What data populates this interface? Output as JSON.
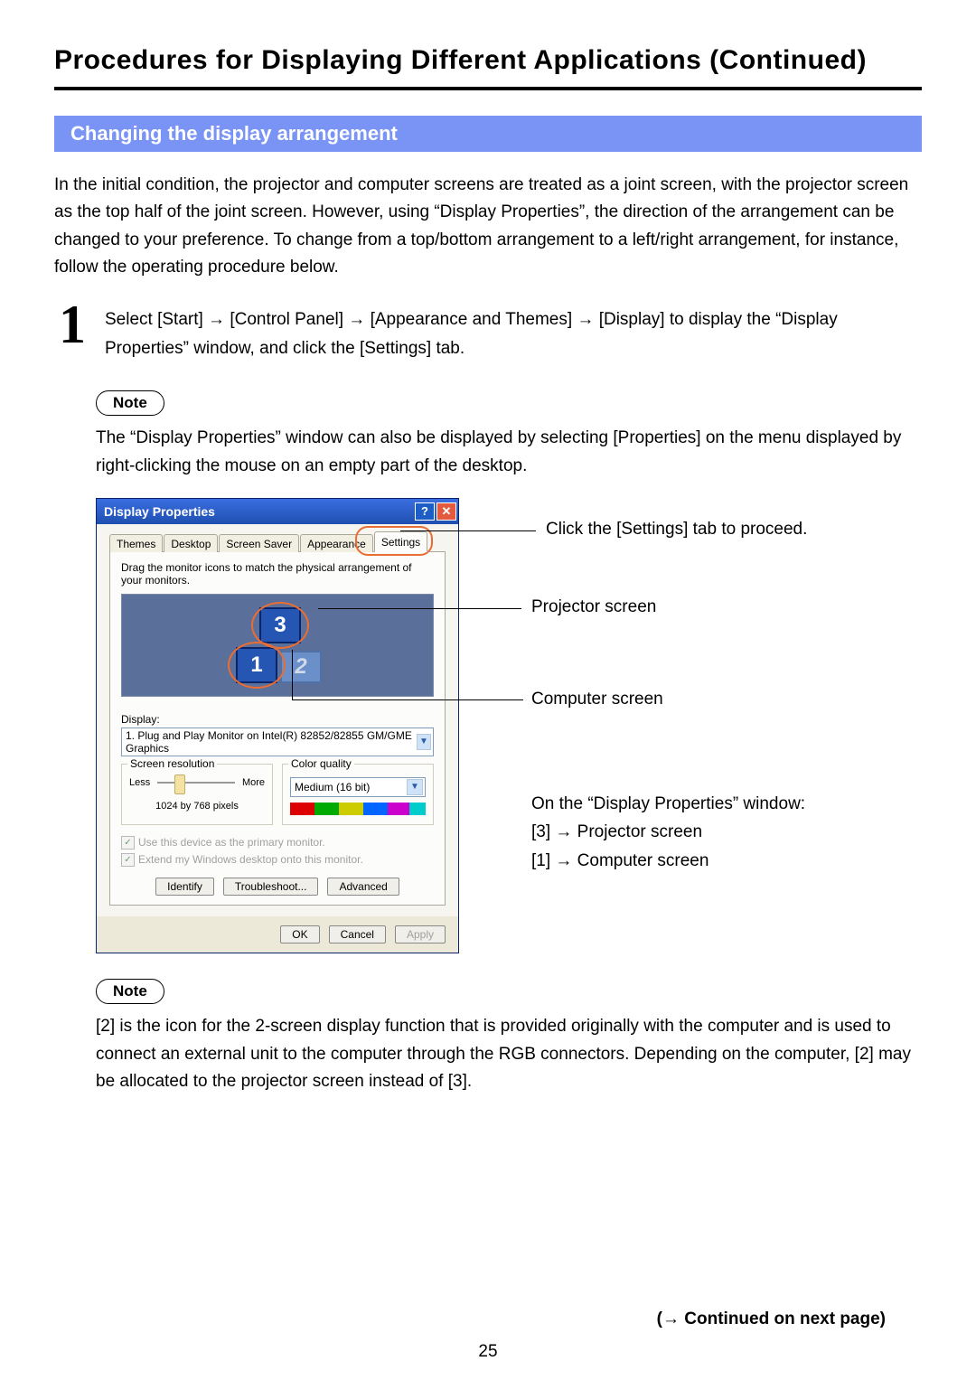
{
  "page_title": "Procedures for Displaying Different Applications (Continued)",
  "section_bar": "Changing the display arrangement",
  "intro": "In the initial condition, the projector and computer screens are treated as a joint screen, with the projector screen as the top half of the joint screen. However, using “Display Properties”, the direction of the arrangement can be changed to your preference. To change from a top/bottom arrangement to a left/right arrangement, for instance, follow the operating procedure below.",
  "step": {
    "number": "1",
    "text": "Select [Start] → [Control Panel] → [Appearance and Themes] → [Display] to display the “Display Properties” window, and click the [Settings] tab."
  },
  "note_label": "Note",
  "note1_text": "The “Display Properties” window can also be displayed by selecting [Properties] on the menu displayed by right-clicking the mouse on an empty part of the desktop.",
  "note2_text": "[2] is the icon for the 2-screen display function that is provided originally with the computer and is used to connect an external unit to the computer through the RGB connectors. Depending on the computer, [2] may be allocated to the projector screen instead of [3].",
  "window": {
    "title": "Display Properties",
    "help": "?",
    "close": "✕",
    "tabs": [
      "Themes",
      "Desktop",
      "Screen Saver",
      "Appearance",
      "Settings"
    ],
    "active_tab": "Settings",
    "drag_text": "Drag the monitor icons to match the physical arrangement of your monitors.",
    "monitors": {
      "m1": "1",
      "m2": "2",
      "m3": "3"
    },
    "display_label": "Display:",
    "display_value": "1. Plug and Play Monitor on Intel(R) 82852/82855 GM/GME Graphics",
    "screen_res_label": "Screen resolution",
    "less": "Less",
    "more": "More",
    "res_text": "1024 by 768 pixels",
    "color_quality_label": "Color quality",
    "color_quality_value": "Medium (16 bit)",
    "chk_primary": "Use this device as the primary monitor.",
    "chk_extend": "Extend my Windows desktop onto this monitor.",
    "btn_identify": "Identify",
    "btn_troubleshoot": "Troubleshoot...",
    "btn_advanced": "Advanced",
    "btn_ok": "OK",
    "btn_cancel": "Cancel",
    "btn_apply": "Apply"
  },
  "callouts": {
    "settings": "Click the [Settings] tab to proceed.",
    "projector": "Projector screen",
    "computer": "Computer screen",
    "map_title": "On the “Display Properties” window:",
    "map_3": "[3] → Projector screen",
    "map_1": "[1] → Computer screen"
  },
  "footer": {
    "continued": "(→ Continued on next page)",
    "page_num": "25"
  }
}
